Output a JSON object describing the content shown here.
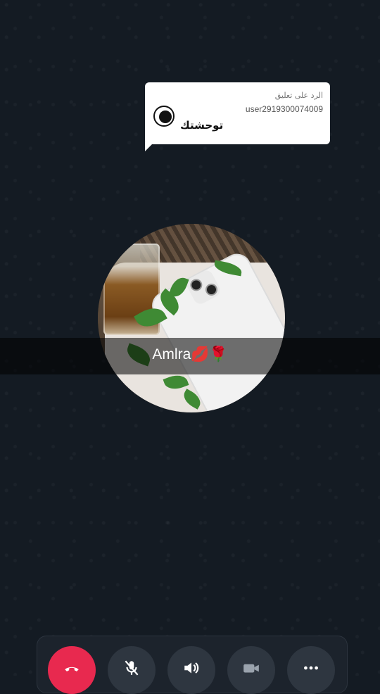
{
  "reply": {
    "header": "الرد على تعليق",
    "username": "user2919300074009",
    "comment": "توحشتك"
  },
  "video": {
    "caller_name": "Amlra💋🌹"
  },
  "controls": [
    {
      "id": "end-call",
      "icon": "phone-hangup-icon",
      "color": "#e8294f"
    },
    {
      "id": "mute",
      "icon": "mic-off-icon"
    },
    {
      "id": "speaker",
      "icon": "speaker-icon"
    },
    {
      "id": "video",
      "icon": "video-camera-icon"
    },
    {
      "id": "more",
      "icon": "more-dots-icon"
    }
  ]
}
